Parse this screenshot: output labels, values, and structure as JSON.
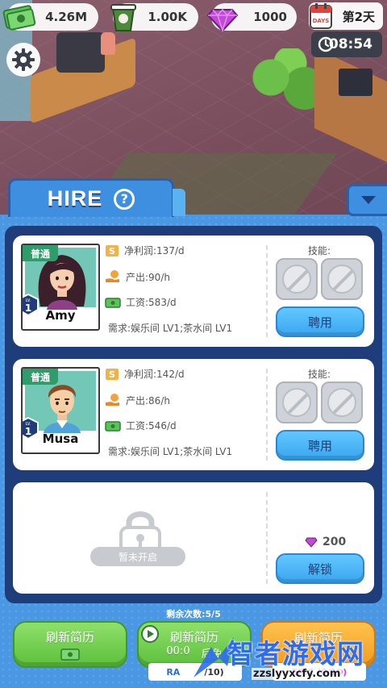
{
  "stats": {
    "money": "4.26M",
    "coffee": "1.00K",
    "gems": "1000",
    "calendar_icon_text": "DAYS",
    "day": "第2天",
    "time": "08:54"
  },
  "hire_panel": {
    "title": "HIRE",
    "help_symbol": "?"
  },
  "candidates": [
    {
      "rank": "普通",
      "level": "1",
      "lv_text": "LV.",
      "name": "Amy",
      "net_profit": "净利润:137/d",
      "output": "产出:90/h",
      "salary": "工资:583/d",
      "requirement": "需求:娱乐间 LV1;茶水间 LV1",
      "skills_label": "技能:",
      "hire_label": "聘用"
    },
    {
      "rank": "普通",
      "level": "1",
      "lv_text": "LV.",
      "name": "Musa",
      "net_profit": "净利润:142/d",
      "output": "产出:86/h",
      "salary": "工资:546/d",
      "requirement": "需求:娱乐间 LV1;茶水间 LV1",
      "skills_label": "技能:",
      "hire_label": "聘用"
    }
  ],
  "locked_slot": {
    "status": "暂未开启",
    "price": "200",
    "unlock_label": "解锁"
  },
  "refresh": {
    "remaining": "剩余次数:5/5",
    "button_basic": "刷新简历",
    "button_ad": "刷新简历",
    "ad_timer": "00:0",
    "ad_timer_tail": "后免",
    "ad_sub": "RA",
    "ad_sub_count": "/10)",
    "button_epic": "刷新简历",
    "epic_sub": "EPIC (0/10)"
  },
  "watermark": {
    "text": "智者游戏网",
    "url": "zzslyyxcfy.com"
  },
  "colors": {
    "panel_blue": "#4a97e4",
    "panel_frame": "#1e3d7a",
    "hire_button": "#3aa5f0",
    "rank_green": "#2f9d6b",
    "refresh_green": "#5cbf3c",
    "refresh_orange": "#f39a1f"
  }
}
